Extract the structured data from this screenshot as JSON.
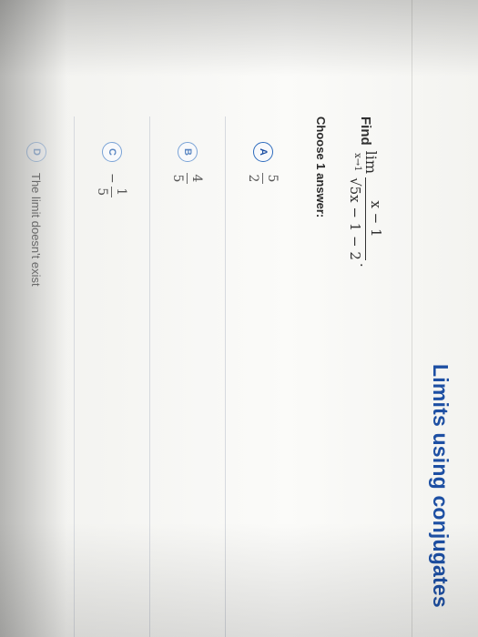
{
  "header": {
    "title": "Limits using conjugates"
  },
  "question": {
    "prefix": "Find",
    "lim": "lim",
    "approach": "x→1",
    "numerator": "x − 1",
    "denominator": "√5x − 1 − 2",
    "suffix": "."
  },
  "instructions": "Choose 1 answer:",
  "choices": [
    {
      "letter": "A",
      "sign": "",
      "num": "5",
      "den": "2"
    },
    {
      "letter": "B",
      "sign": "",
      "num": "4",
      "den": "5"
    },
    {
      "letter": "C",
      "sign": "−",
      "num": "1",
      "den": "5"
    },
    {
      "letter": "D",
      "text": "The limit doesn't exist"
    }
  ],
  "colors": {
    "title": "#1d4fa3",
    "choice_ring": "#7aa3d6"
  }
}
